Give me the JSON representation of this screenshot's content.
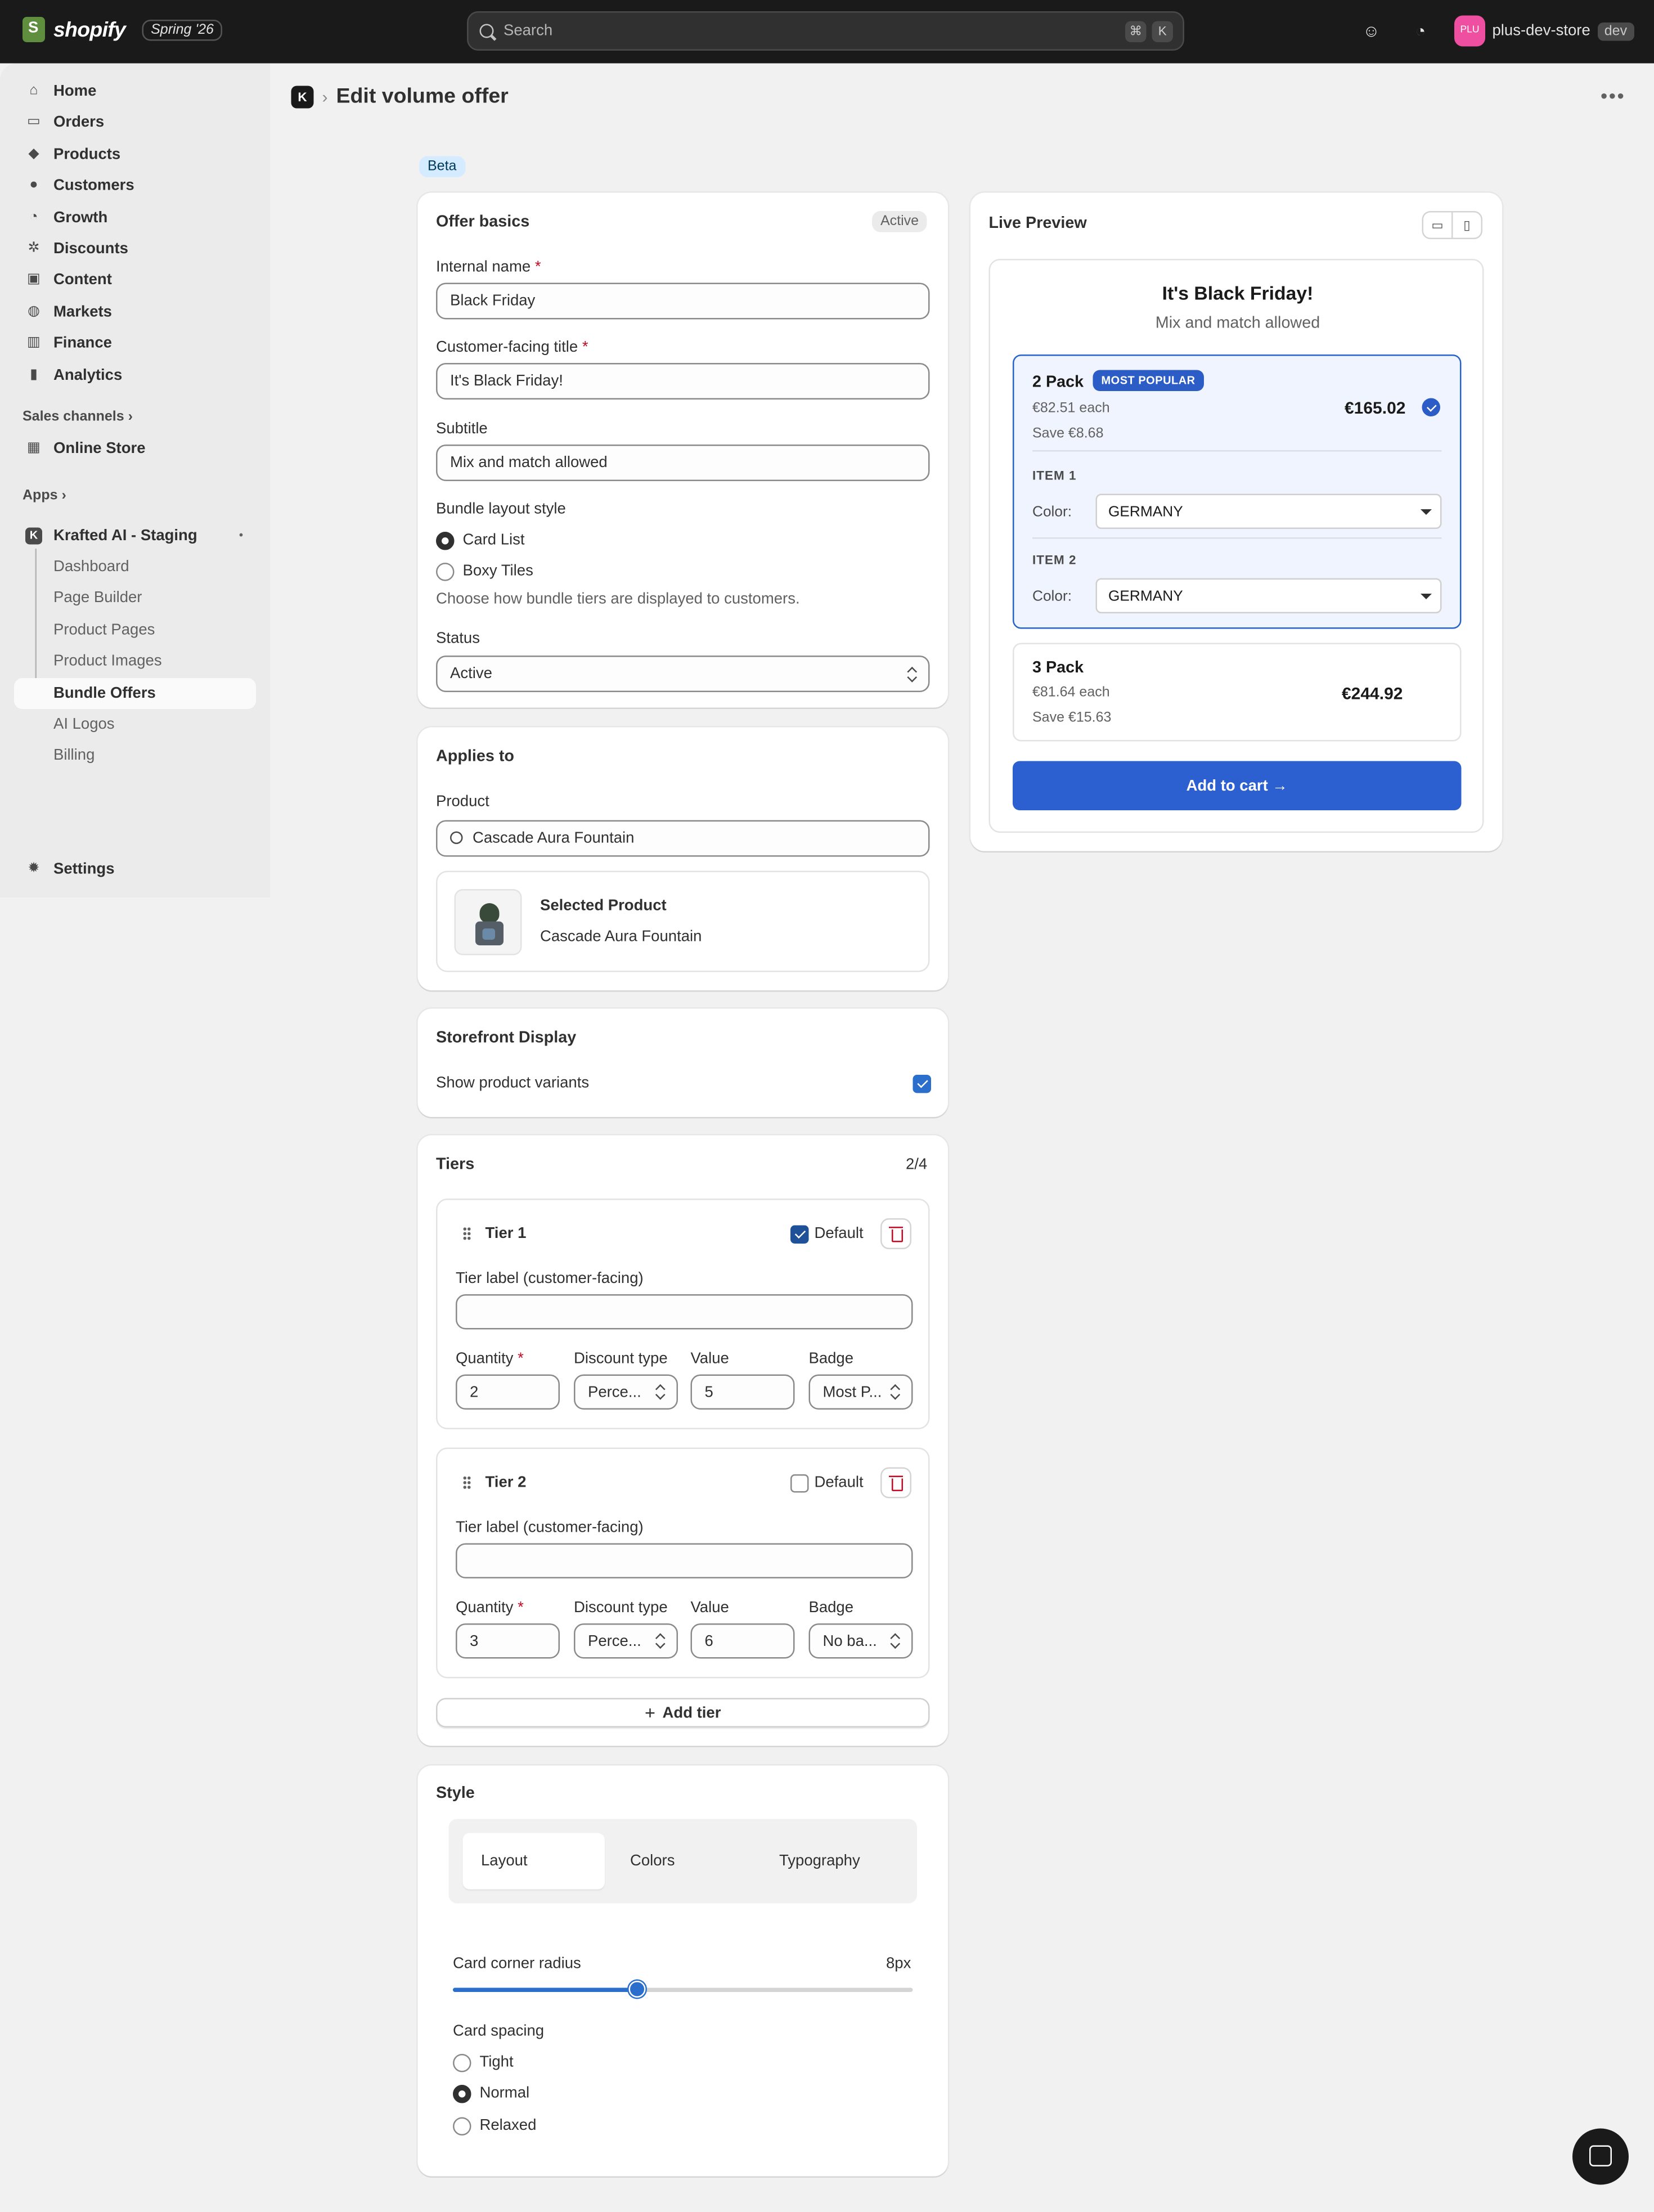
{
  "topbar": {
    "brand": "shopify",
    "season": "Spring '26",
    "search_placeholder": "Search",
    "shortcut_cmd": "⌘",
    "shortcut_key": "K",
    "store_initials": "PLU",
    "store_name": "plus-dev-store",
    "store_badge": "dev"
  },
  "sidebar": {
    "items": [
      {
        "label": "Home",
        "icon": "home-icon",
        "glyph": "⌂"
      },
      {
        "label": "Orders",
        "icon": "inbox-icon",
        "glyph": "▭"
      },
      {
        "label": "Products",
        "icon": "tag-icon",
        "glyph": "◆"
      },
      {
        "label": "Customers",
        "icon": "person-icon",
        "glyph": "●"
      },
      {
        "label": "Growth",
        "icon": "gauge-icon",
        "glyph": "◔"
      },
      {
        "label": "Discounts",
        "icon": "discount-icon",
        "glyph": "✲"
      },
      {
        "label": "Content",
        "icon": "image-icon",
        "glyph": "▣"
      },
      {
        "label": "Markets",
        "icon": "globe-icon",
        "glyph": "◍"
      },
      {
        "label": "Finance",
        "icon": "bank-icon",
        "glyph": "▥"
      },
      {
        "label": "Analytics",
        "icon": "chart-icon",
        "glyph": "▮"
      }
    ],
    "sales_channels_label": "Sales channels",
    "online_store_label": "Online Store",
    "apps_label": "Apps",
    "app_name": "Krafted AI - Staging",
    "app_subitems": [
      "Dashboard",
      "Page Builder",
      "Product Pages",
      "Product Images",
      "Bundle Offers",
      "AI Logos",
      "Billing"
    ],
    "settings_label": "Settings"
  },
  "header": {
    "app_icon_letter": "K",
    "title": "Edit volume offer",
    "beta": "Beta"
  },
  "offer_basics": {
    "title": "Offer basics",
    "status_badge": "Active",
    "internal_name_label": "Internal name",
    "internal_name_value": "Black Friday",
    "customer_title_label": "Customer-facing title",
    "customer_title_value": "It's Black Friday!",
    "subtitle_label": "Subtitle",
    "subtitle_value": "Mix and match allowed",
    "layout_label": "Bundle layout style",
    "layout_options": [
      "Card List",
      "Boxy Tiles"
    ],
    "layout_hint": "Choose how bundle tiers are displayed to customers.",
    "status_label": "Status",
    "status_value": "Active"
  },
  "applies_to": {
    "title": "Applies to",
    "product_label": "Product",
    "product_search_value": "Cascade Aura Fountain",
    "selected_heading": "Selected Product",
    "selected_name": "Cascade Aura Fountain"
  },
  "storefront": {
    "title": "Storefront Display",
    "variants_label": "Show product variants"
  },
  "tiers": {
    "title": "Tiers",
    "count": "2/4",
    "default_label": "Default",
    "tier_label_field": "Tier label (customer-facing)",
    "quantity_label": "Quantity",
    "discount_type_label": "Discount type",
    "value_label": "Value",
    "badge_label": "Badge",
    "items": [
      {
        "name": "Tier 1",
        "quantity": "2",
        "discount_type": "Perce...",
        "value": "5",
        "badge": "Most P..."
      },
      {
        "name": "Tier 2",
        "quantity": "3",
        "discount_type": "Perce...",
        "value": "6",
        "badge": "No ba..."
      }
    ],
    "add_tier_label": "Add tier"
  },
  "style": {
    "title": "Style",
    "tabs": [
      "Layout",
      "Colors",
      "Typography"
    ],
    "radius_label": "Card corner radius",
    "radius_value": "8px",
    "radius_fraction": 0.4,
    "spacing_label": "Card spacing",
    "spacing_options": [
      "Tight",
      "Normal",
      "Relaxed"
    ]
  },
  "preview": {
    "title": "Live Preview",
    "heading": "It's Black Friday!",
    "subheading": "Mix and match allowed",
    "pack1": {
      "name": "2 Pack",
      "badge": "MOST POPULAR",
      "each": "€82.51 each",
      "save": "Save €8.68",
      "price": "€165.02",
      "item1_label": "ITEM 1",
      "item2_label": "ITEM 2",
      "color_label": "Color:",
      "color_value": "GERMANY"
    },
    "pack2": {
      "name": "3 Pack",
      "each": "€81.64 each",
      "save": "Save €15.63",
      "price": "€244.92"
    },
    "cart_label": "Add to cart →"
  },
  "colors": {
    "accent": "#2c5cc5",
    "checkbox": "#1f5199",
    "required": "#c70a24"
  }
}
